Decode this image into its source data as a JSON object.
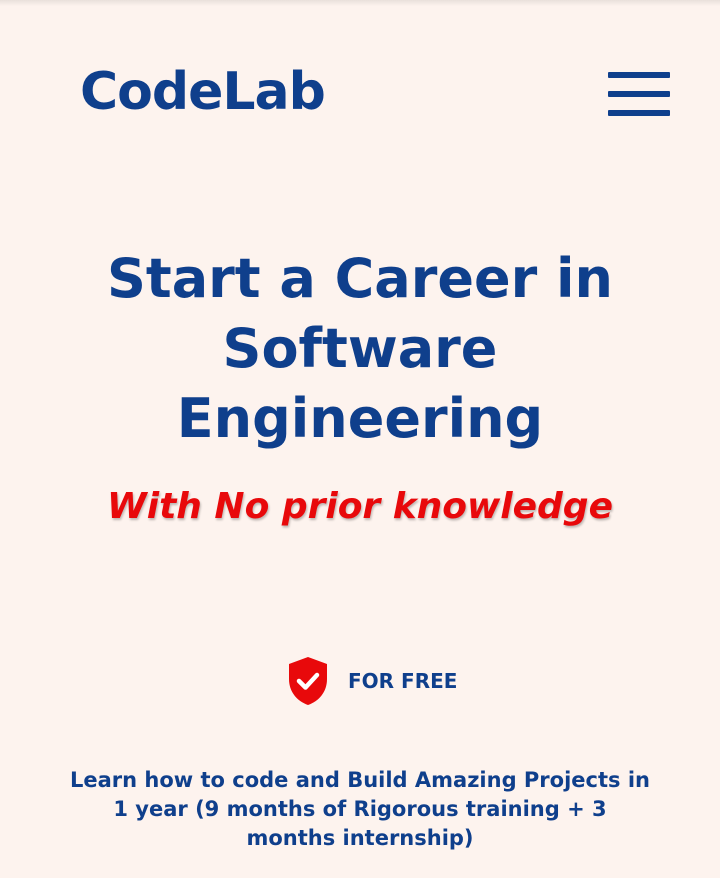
{
  "header": {
    "logo_text": "CodeLab",
    "menu_icon": "hamburger-menu-icon"
  },
  "hero": {
    "headline": "Start a Career in Software Engineering",
    "subheadline": "With No prior knowledge",
    "badge": {
      "icon": "shield-check-icon",
      "label": "FOR FREE"
    },
    "description": "Learn how to code and Build Amazing Projects in 1 year (9 months of Rigorous training + 3 months internship)"
  },
  "colors": {
    "background": "#fdf3ee",
    "brand_blue": "#0f3f8c",
    "accent_red": "#e8090b"
  }
}
